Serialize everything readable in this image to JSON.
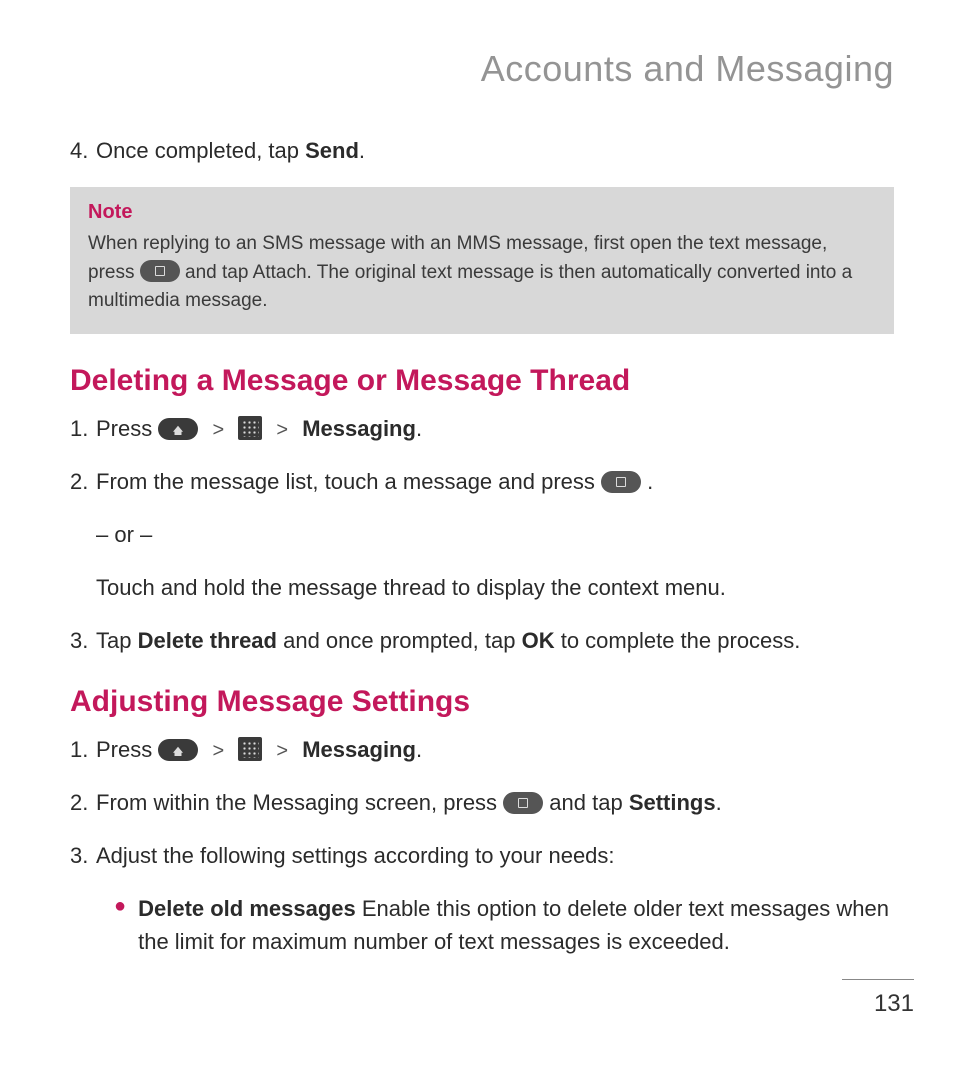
{
  "chapter_title": "Accounts and Messaging",
  "step4": {
    "num": "4.",
    "prefix": "Once completed, tap ",
    "bold": "Send",
    "suffix": "."
  },
  "note": {
    "label": "Note",
    "line1": "When replying to an SMS message with an MMS message, first open the text message, press ",
    "line2": " and tap Attach. The original text message is then automatically converted into a multimedia message."
  },
  "section_delete": {
    "heading": "Deleting a Message or Message Thread",
    "s1": {
      "num": "1.",
      "press": "Press ",
      "sep": ">",
      "messaging": "Messaging",
      "dot": "."
    },
    "s2": {
      "num": "2.",
      "text": "From the message list, touch a message and press ",
      "dot": "."
    },
    "or": "– or –",
    "alt": "Touch and hold the message thread to display the context menu.",
    "s3": {
      "num": "3.",
      "t1": "Tap ",
      "b1": "Delete thread",
      "t2": " and once prompted, tap ",
      "b2": "OK",
      "t3": " to complete the process."
    }
  },
  "section_settings": {
    "heading": "Adjusting Message Settings",
    "s1": {
      "num": "1.",
      "press": "Press ",
      "sep": ">",
      "messaging": "Messaging",
      "dot": "."
    },
    "s2": {
      "num": "2.",
      "t1": "From within the Messaging screen, press ",
      "t2": " and tap ",
      "b": "Settings",
      "dot": "."
    },
    "s3": {
      "num": "3.",
      "text": "Adjust the following settings according to your needs:"
    },
    "bullet": {
      "b": "Delete old messages",
      "rest": " Enable this option to delete older text messages when the limit for maximum number of text messages is exceeded."
    }
  },
  "page_number": "131"
}
